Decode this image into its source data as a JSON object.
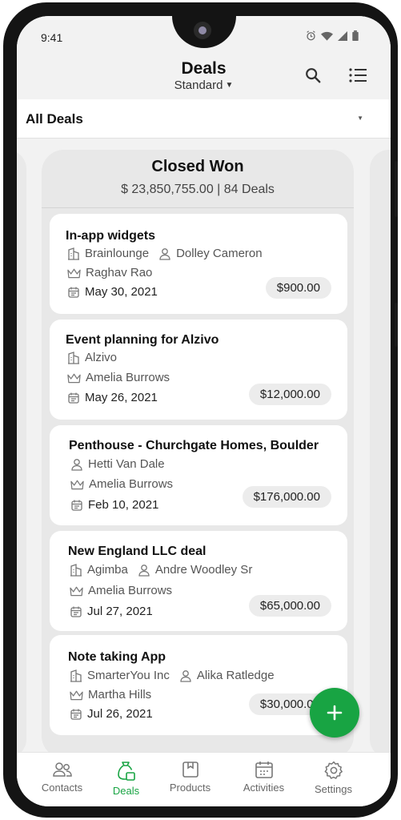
{
  "status_bar": {
    "time": "9:41"
  },
  "header": {
    "title": "Deals",
    "subtitle": "Standard",
    "icons": [
      "search-icon",
      "list-view-icon"
    ]
  },
  "filter": {
    "label": "All Deals"
  },
  "column": {
    "title": "Closed Won",
    "summary": "$ 23,850,755.00 | 84 Deals"
  },
  "cards": [
    {
      "title": "In-app widgets",
      "company": "Brainlounge",
      "contact": "Dolley Cameron",
      "owner": "Raghav Rao",
      "date": "May 30, 2021",
      "amount": "$900.00"
    },
    {
      "title": "Event planning for Alzivo",
      "company": "Alzivo",
      "contact": "",
      "owner": "Amelia Burrows",
      "date": "May 26, 2021",
      "amount": "$12,000.00"
    },
    {
      "title": "Penthouse - Churchgate Homes, Boulder",
      "company": "",
      "contact": "Hetti Van Dale",
      "owner": "Amelia Burrows",
      "date": "Feb 10, 2021",
      "amount": "$176,000.00"
    },
    {
      "title": "New England LLC deal",
      "company": "Agimba",
      "contact": "Andre Woodley Sr",
      "owner": "Amelia Burrows",
      "date": "Jul 27, 2021",
      "amount": "$65,000.00"
    },
    {
      "title": "Note taking App",
      "company": "SmarterYou Inc",
      "contact": "Alika Ratledge",
      "owner": "Martha Hills",
      "date": "Jul 26, 2021",
      "amount": "$30,000.00"
    }
  ],
  "fab": {
    "label": "+"
  },
  "nav": {
    "items": [
      {
        "label": "Contacts",
        "icon": "contacts-icon"
      },
      {
        "label": "Deals",
        "icon": "deals-icon",
        "active": true
      },
      {
        "label": "Products",
        "icon": "products-icon"
      },
      {
        "label": "Activities",
        "icon": "activities-icon"
      },
      {
        "label": "Settings",
        "icon": "settings-icon"
      }
    ]
  },
  "colors": {
    "accent": "#18a443",
    "board_bg": "#f2f2f2",
    "column_bg": "#e8e8e8",
    "card_bg": "#ffffff"
  }
}
